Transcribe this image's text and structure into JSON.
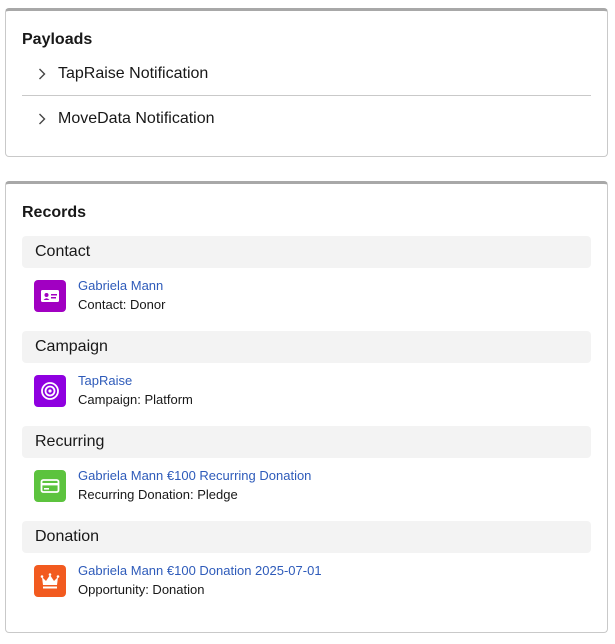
{
  "payloads": {
    "title": "Payloads",
    "items": [
      {
        "label": "TapRaise Notification"
      },
      {
        "label": "MoveData Notification"
      }
    ]
  },
  "records": {
    "title": "Records",
    "sections": [
      {
        "header": "Contact",
        "record": {
          "link": "Gabriela Mann",
          "type": "Contact: Donor",
          "icon": "contact-card-icon",
          "color": "#a100c2"
        }
      },
      {
        "header": "Campaign",
        "record": {
          "link": "TapRaise",
          "type": "Campaign: Platform",
          "icon": "target-icon",
          "color": "#8f00e0"
        }
      },
      {
        "header": "Recurring",
        "record": {
          "link": "Gabriela Mann €100 Recurring Donation",
          "type": "Recurring Donation: Pledge",
          "icon": "credit-card-icon",
          "color": "#5cc33e"
        }
      },
      {
        "header": "Donation",
        "record": {
          "link": "Gabriela Mann €100 Donation 2025-07-01",
          "type": "Opportunity: Donation",
          "icon": "crown-icon",
          "color": "#f25a1f"
        }
      }
    ]
  }
}
